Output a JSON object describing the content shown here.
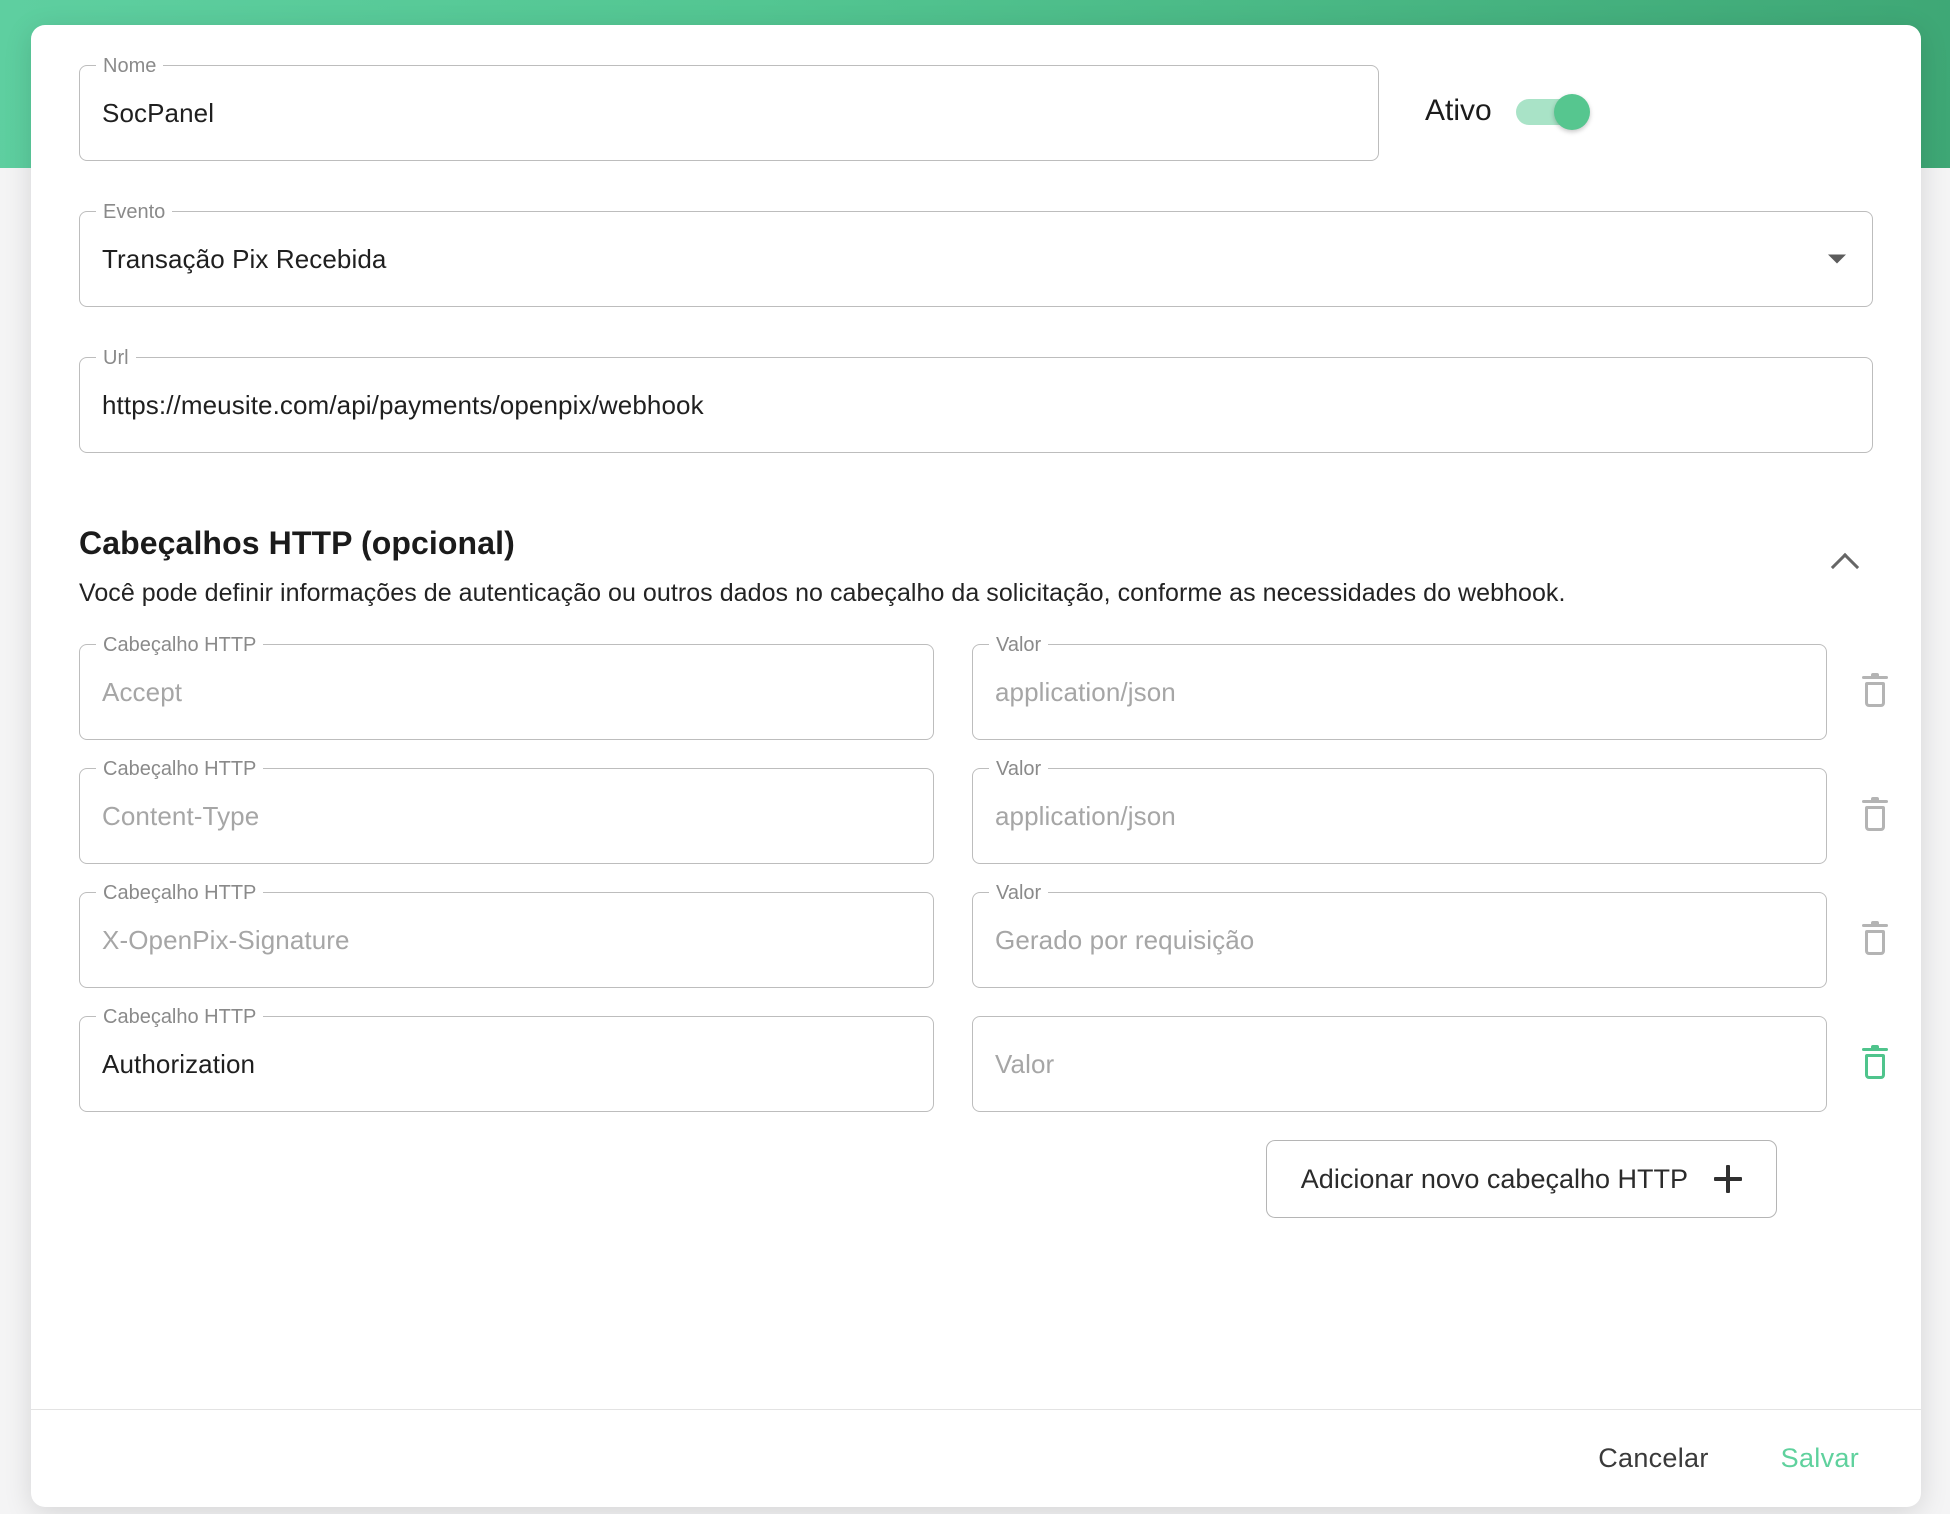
{
  "dialog": {
    "name_field": {
      "label": "Nome",
      "value": "SocPanel"
    },
    "active_toggle": {
      "label": "Ativo",
      "state": "on",
      "accent_color": "#56c68f"
    },
    "event_field": {
      "label": "Evento",
      "value": "Transação Pix Recebida",
      "caret_icon": "chevron-down-icon"
    },
    "url_field": {
      "label": "Url",
      "value": "https://meusite.com/api/payments/openpix/webhook"
    },
    "headers_section": {
      "title": "Cabeçalhos HTTP (opcional)",
      "description": "Você pode definir informações de autenticação ou outros dados no cabeçalho da solicitação, conforme as necessidades do webhook.",
      "collapse_icon": "chevron-up-icon",
      "key_label": "Cabeçalho HTTP",
      "value_label": "Valor",
      "rows": [
        {
          "key_label": "Cabeçalho HTTP",
          "key_text": "Accept",
          "key_is_placeholder": true,
          "value_label": "Valor",
          "value_text": "application/json",
          "value_is_placeholder": true,
          "delete_icon": "trash-icon",
          "delete_active": false
        },
        {
          "key_label": "Cabeçalho HTTP",
          "key_text": "Content-Type",
          "key_is_placeholder": true,
          "value_label": "Valor",
          "value_text": "application/json",
          "value_is_placeholder": true,
          "delete_icon": "trash-icon",
          "delete_active": false
        },
        {
          "key_label": "Cabeçalho HTTP",
          "key_text": "X-OpenPix-Signature",
          "key_is_placeholder": true,
          "value_label": "Valor",
          "value_text": "Gerado por requisição",
          "value_is_placeholder": true,
          "delete_icon": "trash-icon",
          "delete_active": false
        },
        {
          "key_label": "Cabeçalho HTTP",
          "key_text": "Authorization",
          "key_is_placeholder": false,
          "value_label": "",
          "value_text": "Valor",
          "value_is_placeholder": true,
          "delete_icon": "trash-icon",
          "delete_active": true
        }
      ],
      "add_button": {
        "label": "Adicionar novo cabeçalho HTTP",
        "icon": "plus-icon"
      }
    },
    "footer": {
      "cancel_label": "Cancelar",
      "save_label": "Salvar",
      "save_color": "#5fd19d"
    }
  }
}
